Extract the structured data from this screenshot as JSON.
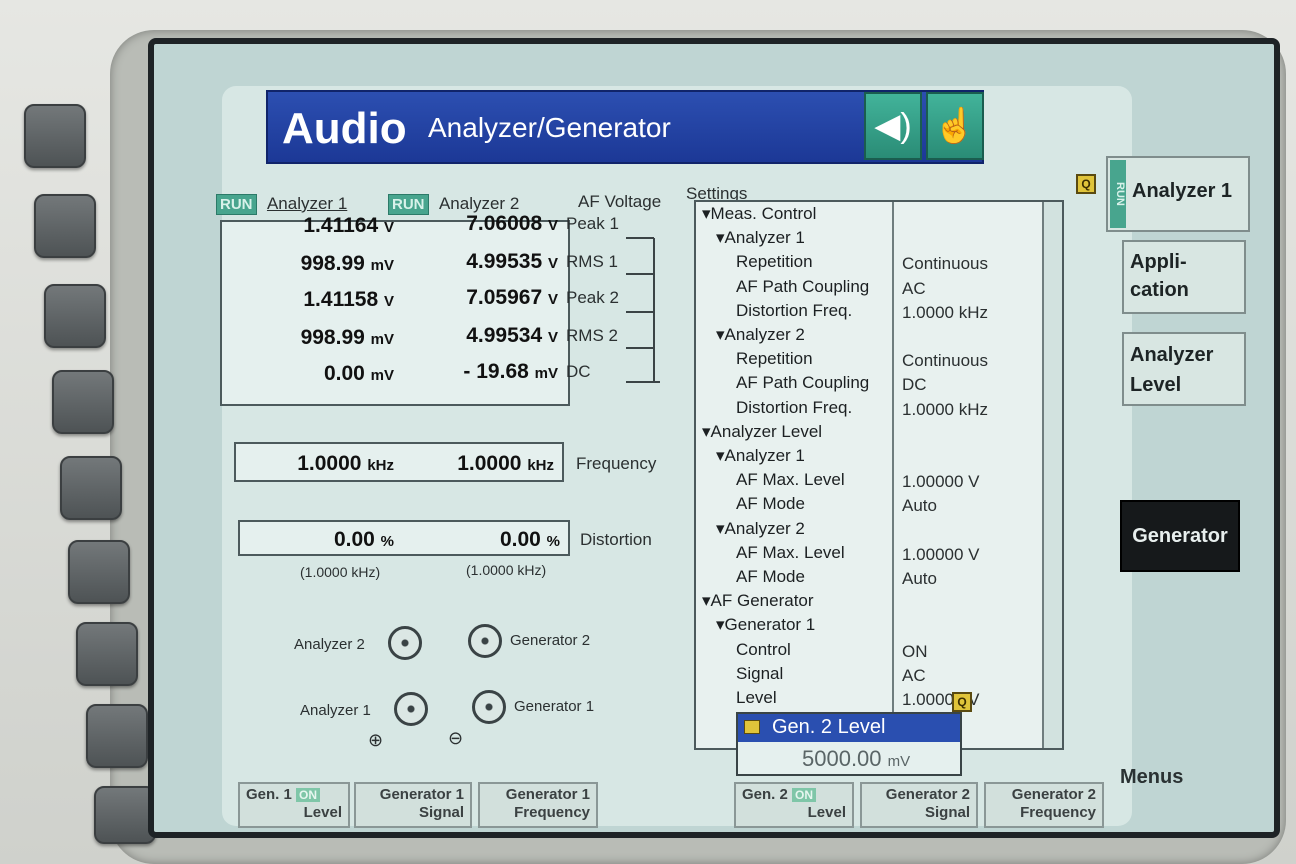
{
  "title": {
    "main": "Audio",
    "sub": "Analyzer/Generator"
  },
  "icons": {
    "speaker": "speaker-wave-icon",
    "touch": "touch-hand-icon"
  },
  "analyzers": {
    "run_label": "RUN",
    "analyzer1_label": "Analyzer 1",
    "analyzer2_label": "Analyzer 2",
    "af_voltage_label": "AF Voltage",
    "rows": [
      {
        "a1": "1.41164",
        "a1_unit": "V",
        "a2": "7.06008",
        "a2_unit": "V",
        "name": "Peak 1"
      },
      {
        "a1": "998.99",
        "a1_unit": "mV",
        "a2": "4.99535",
        "a2_unit": "V",
        "name": "RMS 1"
      },
      {
        "a1": "1.41158",
        "a1_unit": "V",
        "a2": "7.05967",
        "a2_unit": "V",
        "name": "Peak 2"
      },
      {
        "a1": "998.99",
        "a1_unit": "mV",
        "a2": "4.99534",
        "a2_unit": "V",
        "name": "RMS 2"
      },
      {
        "a1": "0.00",
        "a1_unit": "mV",
        "a2": "- 19.68",
        "a2_unit": "mV",
        "name": "DC"
      }
    ],
    "frequency": {
      "a1": "1.0000",
      "a1_unit": "kHz",
      "a2": "1.0000",
      "a2_unit": "kHz",
      "label": "Frequency"
    },
    "distortion": {
      "a1": "0.00",
      "a1_unit": "%",
      "a2": "0.00",
      "a2_unit": "%",
      "label": "Distortion",
      "a1_sub": "(1.0000 kHz)",
      "a2_sub": "(1.0000 kHz)"
    }
  },
  "connectors": {
    "analyzer2": "Analyzer 2",
    "generator2": "Generator 2",
    "analyzer1": "Analyzer 1",
    "generator1": "Generator 1",
    "in_symbol": "⊕",
    "out_symbol": "⊖"
  },
  "settings": {
    "label": "Settings",
    "items": [
      {
        "indent": 0,
        "text": "Meas. Control",
        "value": ""
      },
      {
        "indent": 1,
        "text": "Analyzer 1",
        "value": ""
      },
      {
        "indent": 2,
        "text": "Repetition",
        "value": "Continuous"
      },
      {
        "indent": 2,
        "text": "AF Path Coupling",
        "value": "AC"
      },
      {
        "indent": 2,
        "text": "Distortion Freq.",
        "value": "1.0000  kHz"
      },
      {
        "indent": 1,
        "text": "Analyzer 2",
        "value": ""
      },
      {
        "indent": 2,
        "text": "Repetition",
        "value": "Continuous"
      },
      {
        "indent": 2,
        "text": "AF Path Coupling",
        "value": "DC"
      },
      {
        "indent": 2,
        "text": "Distortion Freq.",
        "value": "1.0000  kHz"
      },
      {
        "indent": 0,
        "text": "Analyzer Level",
        "value": ""
      },
      {
        "indent": 1,
        "text": "Analyzer 1",
        "value": ""
      },
      {
        "indent": 2,
        "text": "AF Max. Level",
        "value": "1.00000  V"
      },
      {
        "indent": 2,
        "text": "AF Mode",
        "value": "Auto"
      },
      {
        "indent": 1,
        "text": "Analyzer 2",
        "value": ""
      },
      {
        "indent": 2,
        "text": "AF Max. Level",
        "value": "1.00000  V"
      },
      {
        "indent": 2,
        "text": "AF Mode",
        "value": "Auto"
      },
      {
        "indent": 0,
        "text": "AF Generator",
        "value": ""
      },
      {
        "indent": 1,
        "text": "Generator 1",
        "value": ""
      },
      {
        "indent": 2,
        "text": "Control",
        "value": "ON"
      },
      {
        "indent": 2,
        "text": "Signal",
        "value": "AC"
      },
      {
        "indent": 2,
        "text": "Level",
        "value": "1.00000  V"
      }
    ]
  },
  "popup": {
    "title": "Gen. 2 Level",
    "value": "5000.00",
    "unit": "mV"
  },
  "softkeys": {
    "analyzer1": "Analyzer 1",
    "analyzer1_tag": "RUN",
    "application": "Appli-\ncation",
    "analyzer_level": "Analyzer\nLevel",
    "generator": "Generator",
    "menus": "Menus"
  },
  "bottom_keys": [
    {
      "line1": "Gen. 1",
      "badge": "ON",
      "line2": "Level"
    },
    {
      "line1": "Generator 1",
      "badge": "",
      "line2": "Signal"
    },
    {
      "line1": "Generator 1",
      "badge": "",
      "line2": "Frequency"
    },
    {
      "line1": "Gen. 2",
      "badge": "ON",
      "line2": "Level"
    },
    {
      "line1": "Generator 2",
      "badge": "",
      "line2": "Signal"
    },
    {
      "line1": "Generator 2",
      "badge": "",
      "line2": "Frequency"
    }
  ],
  "colors": {
    "title_blue": "#2c4fb1",
    "run_green": "#48a58e",
    "screen_bg": "#bfd5d3"
  }
}
